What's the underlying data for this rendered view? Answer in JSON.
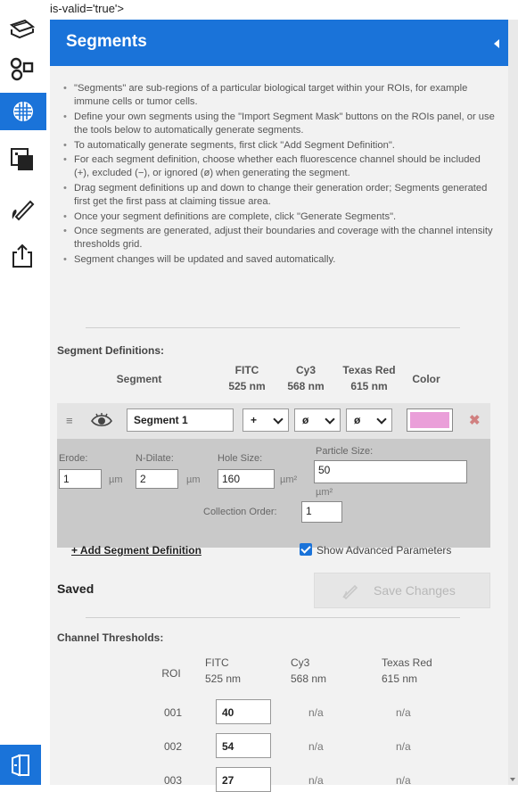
{
  "stray_text": "is-valid='true'>",
  "rail": {
    "icons": [
      "scanner-icon",
      "link-nodes-icon",
      "segments-icon",
      "layers-icon",
      "pen-icon",
      "share-icon",
      "exit-icon"
    ]
  },
  "panel": {
    "title": "Segments",
    "instructions": [
      "\"Segments\" are sub-regions of a particular biological target within your ROIs, for example immune cells or tumor cells.",
      "Define your own segments using the \"Import Segment Mask\" buttons on the ROIs panel, or use the tools below to automatically generate segments.",
      "To automatically generate segments, first click \"Add Segment Definition\".",
      "For each segment definition, choose whether each fluorescence channel should be included (+), excluded (−), or ignored (ø) when generating the segment.",
      "Drag segment definitions up and down to change their generation order; Segments generated first get the first pass at claiming tissue area.",
      "Once your segment definitions are complete, click \"Generate Segments\".",
      "Once segments are generated, adjust their boundaries and coverage with the channel intensity thresholds grid.",
      "Segment changes will be updated and saved automatically."
    ],
    "segment_definitions": {
      "title": "Segment Definitions:",
      "col_segment": "Segment",
      "channels": [
        {
          "name": "FITC",
          "wavelength": "525 nm"
        },
        {
          "name": "Cy3",
          "wavelength": "568 nm"
        },
        {
          "name": "Texas Red",
          "wavelength": "615 nm"
        }
      ],
      "col_color": "Color",
      "segment": {
        "name": "Segment 1",
        "channel_values": [
          "+",
          "ø",
          "ø"
        ],
        "color": "#ea9fd9",
        "erode_label": "Erode:",
        "erode_value": "1",
        "n_dilate_label": "N-Dilate:",
        "n_dilate_value": "2",
        "hole_size_label": "Hole Size:",
        "hole_size_value": "160",
        "particle_size_label": "Particle Size:",
        "particle_size_value": "50",
        "unit_um": "µm",
        "unit_um2": "µm²",
        "collection_order_label": "Collection Order:",
        "collection_order_value": "1"
      }
    },
    "add_segment_label": "+ Add Segment Definition",
    "show_advanced_label": "Show Advanced Parameters",
    "show_advanced_checked": true,
    "status_text": "Saved",
    "save_changes_label": "Save Changes",
    "channel_thresholds": {
      "title": "Channel Thresholds:",
      "col_roi": "ROI",
      "channels": [
        {
          "name": "FITC",
          "wavelength": "525 nm"
        },
        {
          "name": "Cy3",
          "wavelength": "568 nm"
        },
        {
          "name": "Texas Red",
          "wavelength": "615 nm"
        }
      ],
      "rows": [
        {
          "roi": "001",
          "fitc": "40",
          "cy3": "n/a",
          "texas_red": "n/a"
        },
        {
          "roi": "002",
          "fitc": "54",
          "cy3": "n/a",
          "texas_red": "n/a"
        },
        {
          "roi": "003",
          "fitc": "27",
          "cy3": "n/a",
          "texas_red": "n/a"
        }
      ]
    }
  }
}
